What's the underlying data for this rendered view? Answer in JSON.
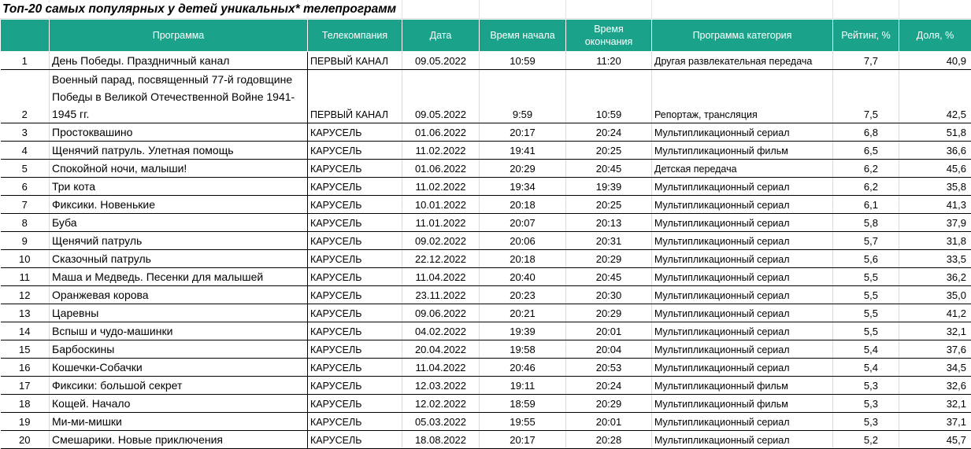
{
  "title": "Топ-20 самых популярных у детей уникальных* телепрограмм",
  "headers": {
    "num": "",
    "program": "Программа",
    "channel": "Телекомпания",
    "date": "Дата",
    "start": "Время начала",
    "end": "Время окончания",
    "category": "Программа категория",
    "rating": "Рейтинг, %",
    "share": "Доля, %"
  },
  "rows": [
    {
      "n": "1",
      "program": "День Победы. Праздничный канал",
      "channel": "ПЕРВЫЙ КАНАЛ",
      "date": "09.05.2022",
      "start": "10:59",
      "end": "11:20",
      "category": "Другая развлекательная передача",
      "rating": "7,7",
      "share": "40,9"
    },
    {
      "n": "2",
      "program": "Военный парад, посвященный 77-й годовщине Победы в Великой Отечественной Войне 1941-1945 гг.",
      "channel": "ПЕРВЫЙ КАНАЛ",
      "date": "09.05.2022",
      "start": "9:59",
      "end": "10:59",
      "category": "Репортаж, трансляция",
      "rating": "7,5",
      "share": "42,5"
    },
    {
      "n": "3",
      "program": "Простоквашино",
      "channel": "КАРУСЕЛЬ",
      "date": "01.06.2022",
      "start": "20:17",
      "end": "20:24",
      "category": "Мультипликационный сериал",
      "rating": "6,8",
      "share": "51,8"
    },
    {
      "n": "4",
      "program": "Щенячий патруль. Улетная помощь",
      "channel": "КАРУСЕЛЬ",
      "date": "11.02.2022",
      "start": "19:41",
      "end": "20:25",
      "category": "Мультипликационный фильм",
      "rating": "6,5",
      "share": "36,6"
    },
    {
      "n": "5",
      "program": "Спокойной ночи, малыши!",
      "channel": "КАРУСЕЛЬ",
      "date": "01.06.2022",
      "start": "20:29",
      "end": "20:45",
      "category": "Детская передача",
      "rating": "6,2",
      "share": "45,6"
    },
    {
      "n": "6",
      "program": "Три кота",
      "channel": "КАРУСЕЛЬ",
      "date": "11.02.2022",
      "start": "19:34",
      "end": "19:39",
      "category": "Мультипликационный сериал",
      "rating": "6,2",
      "share": "35,8"
    },
    {
      "n": "7",
      "program": "Фиксики. Новенькие",
      "channel": "КАРУСЕЛЬ",
      "date": "10.01.2022",
      "start": "20:18",
      "end": "20:25",
      "category": "Мультипликационный сериал",
      "rating": "6,1",
      "share": "41,3"
    },
    {
      "n": "8",
      "program": "Буба",
      "channel": "КАРУСЕЛЬ",
      "date": "11.01.2022",
      "start": "20:07",
      "end": "20:13",
      "category": "Мультипликационный сериал",
      "rating": "5,8",
      "share": "37,9"
    },
    {
      "n": "9",
      "program": "Щенячий патруль",
      "channel": "КАРУСЕЛЬ",
      "date": "09.02.2022",
      "start": "20:06",
      "end": "20:31",
      "category": "Мультипликационный сериал",
      "rating": "5,7",
      "share": "31,8"
    },
    {
      "n": "10",
      "program": "Сказочный патруль",
      "channel": "КАРУСЕЛЬ",
      "date": "22.12.2022",
      "start": "20:18",
      "end": "20:29",
      "category": "Мультипликационный сериал",
      "rating": "5,6",
      "share": "33,5"
    },
    {
      "n": "11",
      "program": "Маша и Медведь. Песенки для малышей",
      "channel": "КАРУСЕЛЬ",
      "date": "11.04.2022",
      "start": "20:40",
      "end": "20:45",
      "category": "Мультипликационный сериал",
      "rating": "5,5",
      "share": "36,2"
    },
    {
      "n": "12",
      "program": "Оранжевая корова",
      "channel": "КАРУСЕЛЬ",
      "date": "23.11.2022",
      "start": "20:23",
      "end": "20:30",
      "category": "Мультипликационный сериал",
      "rating": "5,5",
      "share": "35,0"
    },
    {
      "n": "13",
      "program": "Царевны",
      "channel": "КАРУСЕЛЬ",
      "date": "09.06.2022",
      "start": "20:21",
      "end": "20:29",
      "category": "Мультипликационный сериал",
      "rating": "5,5",
      "share": "41,2"
    },
    {
      "n": "14",
      "program": "Вспыш и чудо-машинки",
      "channel": "КАРУСЕЛЬ",
      "date": "04.02.2022",
      "start": "19:39",
      "end": "20:01",
      "category": "Мультипликационный сериал",
      "rating": "5,5",
      "share": "32,1"
    },
    {
      "n": "15",
      "program": "Барбоскины",
      "channel": "КАРУСЕЛЬ",
      "date": "20.04.2022",
      "start": "19:58",
      "end": "20:04",
      "category": "Мультипликационный сериал",
      "rating": "5,4",
      "share": "37,6"
    },
    {
      "n": "16",
      "program": "Кошечки-Собачки",
      "channel": "КАРУСЕЛЬ",
      "date": "11.04.2022",
      "start": "20:46",
      "end": "20:53",
      "category": "Мультипликационный сериал",
      "rating": "5,4",
      "share": "34,5"
    },
    {
      "n": "17",
      "program": "Фиксики: большой секрет",
      "channel": "КАРУСЕЛЬ",
      "date": "12.03.2022",
      "start": "19:11",
      "end": "20:24",
      "category": "Мультипликационный фильм",
      "rating": "5,3",
      "share": "32,6"
    },
    {
      "n": "18",
      "program": "Кощей. Начало",
      "channel": "КАРУСЕЛЬ",
      "date": "12.02.2022",
      "start": "18:59",
      "end": "20:29",
      "category": "Мультипликационный фильм",
      "rating": "5,3",
      "share": "32,1"
    },
    {
      "n": "19",
      "program": "Ми-ми-мишки",
      "channel": "КАРУСЕЛЬ",
      "date": "05.03.2022",
      "start": "19:55",
      "end": "20:01",
      "category": "Мультипликационный сериал",
      "rating": "5,3",
      "share": "37,1"
    },
    {
      "n": "20",
      "program": "Смешарики. Новые приключения",
      "channel": "КАРУСЕЛЬ",
      "date": "18.08.2022",
      "start": "20:17",
      "end": "20:28",
      "category": "Мультипликационный сериал",
      "rating": "5,2",
      "share": "45,7"
    }
  ]
}
